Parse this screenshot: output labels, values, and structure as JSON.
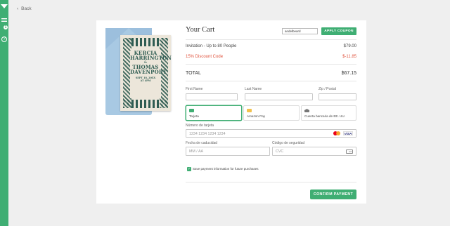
{
  "nav": {
    "back_label": "Back"
  },
  "invitation": {
    "name1_first": "KERCIA",
    "name1_last": "HARRINGTON",
    "amp": "&",
    "name2_first": "THOMAS",
    "name2_last": "DAVENPORT",
    "date_line": "SEPT 18, 20XX",
    "time_line": "AT 4PM"
  },
  "cart": {
    "title": "Your Cart",
    "coupon_value": "andelbeard",
    "coupon_button": "APPLY COUPON",
    "items": [
      {
        "label": "Invitation - Up to 80 People",
        "price": "$79.00"
      },
      {
        "label": "15% Discount Code",
        "price": "$-11.85"
      }
    ],
    "total_label": "TOTAL",
    "total_value": "$67.15"
  },
  "form": {
    "first_name_label": "First Name",
    "last_name_label": "Last Name",
    "zip_label": "Zip / Postal",
    "methods": [
      {
        "label": "Tarjeta",
        "icon": "credit-card-icon"
      },
      {
        "label": "Amazon Pay",
        "icon": "amazon-pay-icon"
      },
      {
        "label": "Cuenta bancaria de EE. UU.",
        "icon": "bank-icon"
      }
    ],
    "card_number_label": "Número de tarjeta",
    "card_number_placeholder": "1234 1234 1234 1234",
    "expiry_label": "Fecha de caducidad",
    "expiry_placeholder": "MM / AA",
    "cvc_label": "Código de seguridad",
    "cvc_placeholder": "CVC",
    "save_label": "Save payment information for future purchases",
    "confirm_button": "CONFIRM PAYMENT"
  },
  "colors": {
    "accent": "#3fae73",
    "discount": "#e0523c"
  }
}
